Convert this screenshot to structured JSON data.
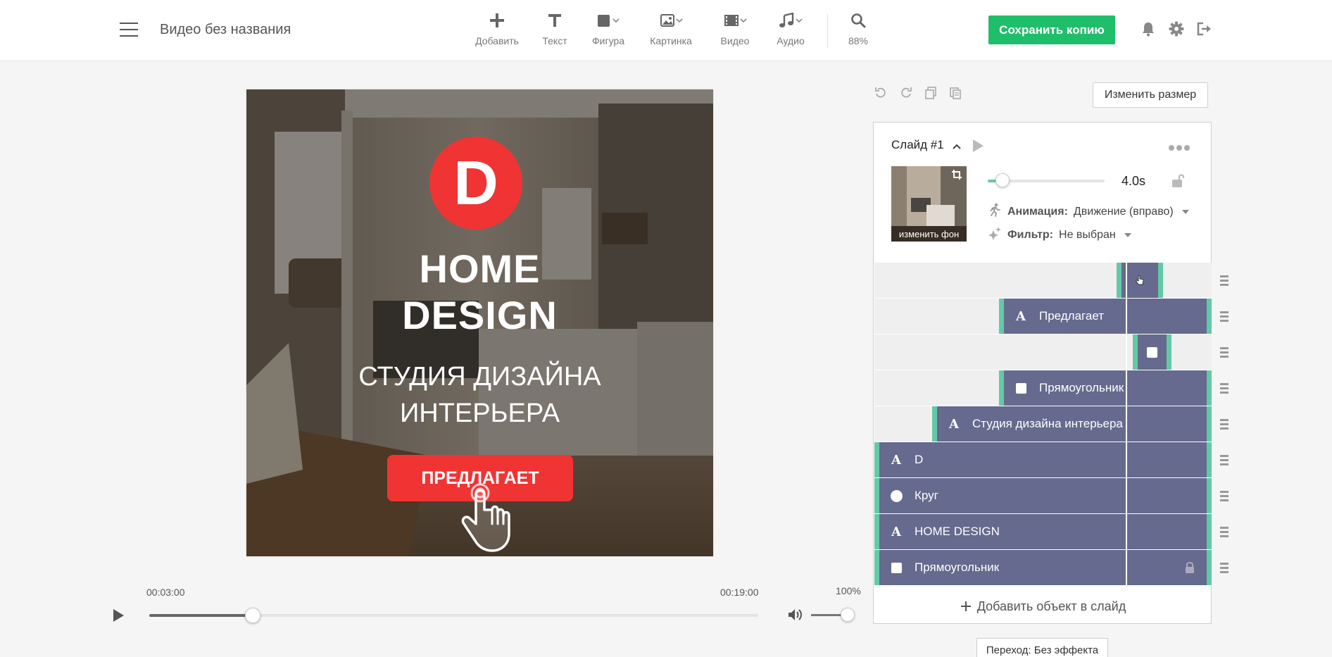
{
  "header": {
    "title": "Видео без названия",
    "tools": [
      {
        "label": "Добавить",
        "icon": "plus-icon"
      },
      {
        "label": "Текст",
        "icon": "text-icon"
      },
      {
        "label": "Фигура",
        "icon": "shape-icon"
      },
      {
        "label": "Картинка",
        "icon": "image-icon"
      },
      {
        "label": "Видео",
        "icon": "video-icon"
      },
      {
        "label": "Аудио",
        "icon": "audio-icon"
      }
    ],
    "zoom": "88%",
    "save_label": "Сохранить копию"
  },
  "canvas": {
    "logo_letter": "D",
    "headline_1": "HOME",
    "headline_2": "DESIGN",
    "subtitle_1": "СТУДИЯ ДИЗАЙНА",
    "subtitle_2": "ИНТЕРЬЕРА",
    "cta": "ПРЕДЛАГАЕТ"
  },
  "player": {
    "current_time": "00:03:00",
    "total_time": "00:19:00",
    "progress_fraction": 0.17,
    "volume": "100%"
  },
  "panel": {
    "resize_label": "Изменить размер",
    "slide_title": "Слайд #1",
    "thumb_label": "изменить фон",
    "duration": "4.0s",
    "animation_label": "Анимация:",
    "animation_value": "Движение (вправо)",
    "filter_label": "Фильтр:",
    "filter_value": "Не выбран",
    "layers": [
      {
        "label": "",
        "icon": "none"
      },
      {
        "label": "Предлагает",
        "icon": "text"
      },
      {
        "label": "",
        "icon": "rect"
      },
      {
        "label": "Прямоугольник",
        "icon": "rect"
      },
      {
        "label": "Студия дизайна интерьера",
        "icon": "text"
      },
      {
        "label": "D",
        "icon": "text"
      },
      {
        "label": "Круг",
        "icon": "circle"
      },
      {
        "label": "HOME DESIGN",
        "icon": "text"
      },
      {
        "label": "Прямоугольник",
        "icon": "rect",
        "locked": true
      }
    ],
    "add_object_label": "Добавить объект в слайд",
    "transition_label": "Переход: Без эффекта"
  },
  "colors": {
    "accent": "#1fbe6b",
    "layer_bar": "#666a8e",
    "layer_edge": "#63c9a6",
    "brand_red": "#f03434"
  }
}
